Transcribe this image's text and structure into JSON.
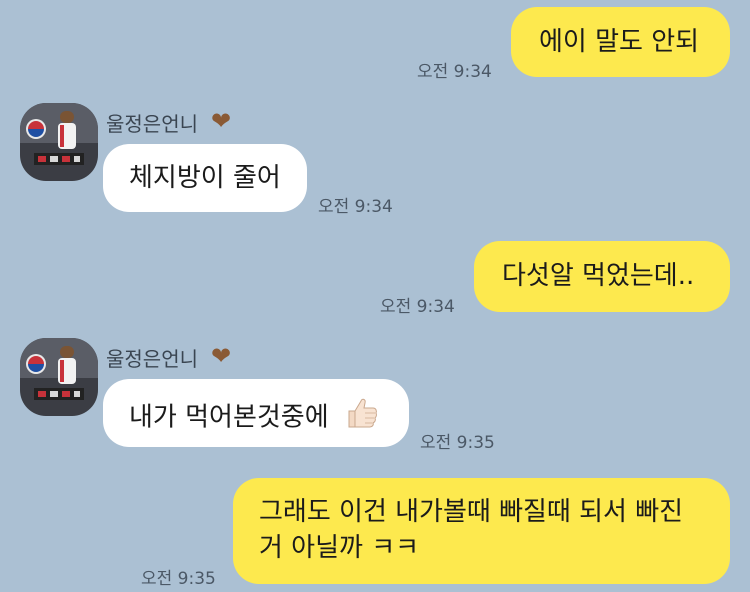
{
  "colors": {
    "background": "#abc0d3",
    "my_bubble": "#fde94e",
    "their_bubble": "#ffffff",
    "heart": "#8a5a35"
  },
  "messages": [
    {
      "sender": "me",
      "text": "에이 말도 안되",
      "time": "오전 9:34"
    },
    {
      "sender": "other",
      "name": "울정은언니",
      "text": "체지방이 줄어",
      "time": "오전 9:34"
    },
    {
      "sender": "me",
      "text": "다섯알 먹었는데..",
      "time": "오전 9:34"
    },
    {
      "sender": "other",
      "name": "울정은언니",
      "text": "내가 먹어본것중에",
      "emoji": "thumbs-up-icon",
      "time": "오전 9:35"
    },
    {
      "sender": "me",
      "lines": [
        "그래도 이건 내가볼때 빠질때 되서 빠진",
        "거 아닐까 ㅋㅋ"
      ],
      "time": "오전 9:35"
    }
  ]
}
